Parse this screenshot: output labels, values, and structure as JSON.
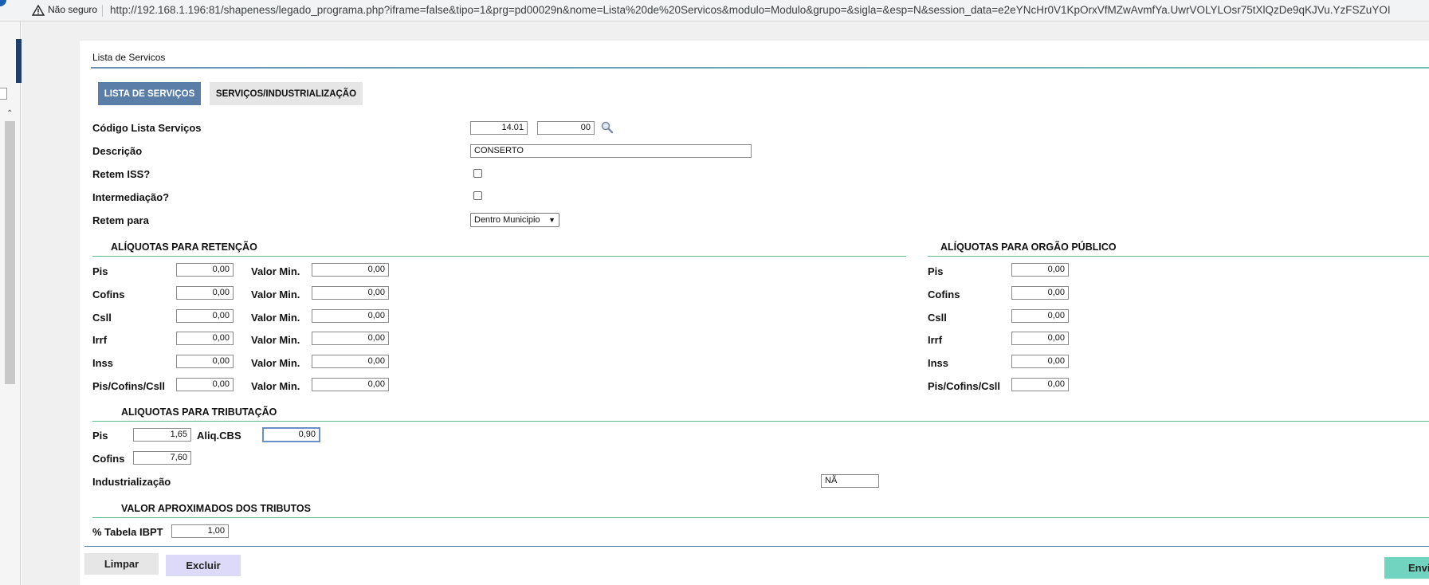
{
  "browser": {
    "security_label": "Não seguro",
    "url": "http://192.168.1.196:81/shapeness/legado_programa.php?iframe=false&tipo=1&prg=pd00029n&nome=Lista%20de%20Servicos&modulo=Modulo&grupo=&sigla=&esp=N&session_data=e2eYNcHr0V1KpOrxVfMZwAvmfYa.UwrVOLYLOsr75tXlQzDe9qKJVu.YzFSZuYOI"
  },
  "page": {
    "title": "Lista de Servicos",
    "tabs": [
      {
        "label": "LISTA DE SERVIÇOS",
        "active": true
      },
      {
        "label": "SERVIÇOS/INDUSTRIALIZAÇÃO",
        "active": false
      }
    ]
  },
  "form": {
    "codigo_label": "Código Lista Serviços",
    "codigo_value": "14.01",
    "codigo_sub_value": "00",
    "descricao_label": "Descrição",
    "descricao_value": "CONSERTO",
    "retem_iss_label": "Retem ISS?",
    "retem_iss_checked": false,
    "intermediacao_label": "Intermediação?",
    "intermediacao_checked": false,
    "retem_para_label": "Retem para",
    "retem_para_value": "Dentro Municipio"
  },
  "retencao": {
    "title": "ALÍQUOTAS PARA RETENÇÃO",
    "valor_min_label": "Valor Min.",
    "rows": [
      {
        "label": "Pis",
        "aliquota": "0,00",
        "valor_min": "0,00"
      },
      {
        "label": "Cofins",
        "aliquota": "0,00",
        "valor_min": "0,00"
      },
      {
        "label": "Csll",
        "aliquota": "0,00",
        "valor_min": "0,00"
      },
      {
        "label": "Irrf",
        "aliquota": "0,00",
        "valor_min": "0,00"
      },
      {
        "label": "Inss",
        "aliquota": "0,00",
        "valor_min": "0,00"
      },
      {
        "label": "Pis/Cofins/Csll",
        "aliquota": "0,00",
        "valor_min": "0,00"
      }
    ]
  },
  "orgao_publico": {
    "title": "ALÍQUOTAS PARA ORGÃO PÚBLICO",
    "rows": [
      {
        "label": "Pis",
        "value": "0,00"
      },
      {
        "label": "Cofins",
        "value": "0,00"
      },
      {
        "label": "Csll",
        "value": "0,00"
      },
      {
        "label": "Irrf",
        "value": "0,00"
      },
      {
        "label": "Inss",
        "value": "0,00"
      },
      {
        "label": "Pis/Cofins/Csll",
        "value": "0,00"
      }
    ]
  },
  "tributacao": {
    "title": "ALIQUOTAS PARA TRIBUTAÇÃO",
    "pis_label": "Pis",
    "pis_value": "1,65",
    "cbs_label": "Aliq.CBS",
    "cbs_value": "0,90",
    "cofins_label": "Cofins",
    "cofins_value": "7,60",
    "industrializacao_label": "Industrialização",
    "industrializacao_value": "NÃ"
  },
  "tributos": {
    "title": "VALOR APROXIMADOS DOS TRIBUTOS",
    "ibpt_label": "% Tabela IBPT",
    "ibpt_value": "1,00"
  },
  "actions": {
    "limpar": "Limpar",
    "excluir": "Excluir",
    "enviar": "Envia"
  },
  "colors": {
    "tab_active": "#5a7ea8",
    "section_line": "#5dbb8c",
    "enviar_button": "#70d4c0",
    "excluir_button": "#dcdaf8"
  }
}
